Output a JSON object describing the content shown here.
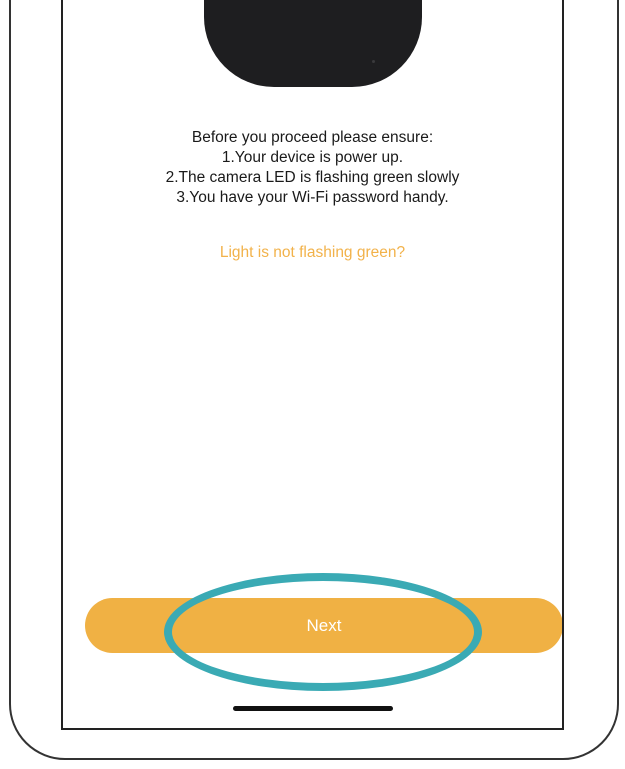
{
  "setup_screen": {
    "instructions": {
      "heading": "Before you proceed please ensure:",
      "steps": [
        "1.Your device is power up.",
        "2.The camera LED is flashing green slowly",
        "3.You have your Wi-Fi password handy."
      ]
    },
    "help_link": "Light is not flashing green?",
    "next_button": "Next"
  },
  "colors": {
    "accent": "#f0b144",
    "link": "#f2b24a",
    "annotation": "#3aaab4",
    "camera": "#1e1e20"
  },
  "icons": {
    "device": "camera-device-image",
    "home_indicator": "home-indicator-bar"
  }
}
